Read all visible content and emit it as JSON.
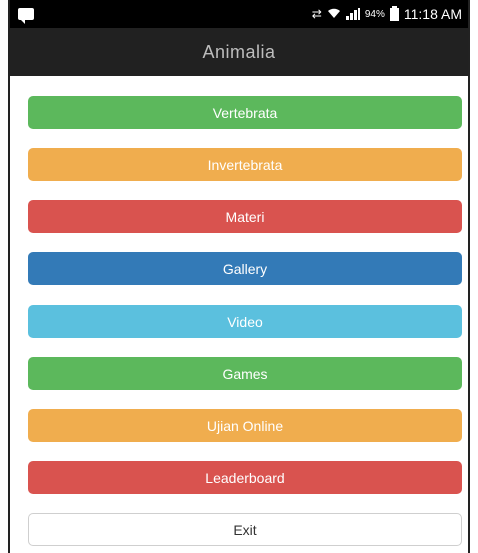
{
  "status_bar": {
    "battery_percent": "94%",
    "time": "11:18 AM",
    "icons": [
      "message-icon",
      "sync-icon",
      "wifi-icon",
      "signal-icon",
      "battery-icon"
    ]
  },
  "app_bar": {
    "title": "Animalia"
  },
  "menu": {
    "buttons": [
      {
        "label": "Vertebrata",
        "color": "#5cb85c"
      },
      {
        "label": "Invertebrata",
        "color": "#f0ad4e"
      },
      {
        "label": "Materi",
        "color": "#d9534f"
      },
      {
        "label": "Gallery",
        "color": "#337ab7"
      },
      {
        "label": "Video",
        "color": "#5bc0de"
      },
      {
        "label": "Games",
        "color": "#5cb85c"
      },
      {
        "label": "Ujian Online",
        "color": "#f0ad4e"
      },
      {
        "label": "Leaderboard",
        "color": "#d9534f"
      },
      {
        "label": "Exit",
        "color": "#ffffff"
      }
    ]
  }
}
